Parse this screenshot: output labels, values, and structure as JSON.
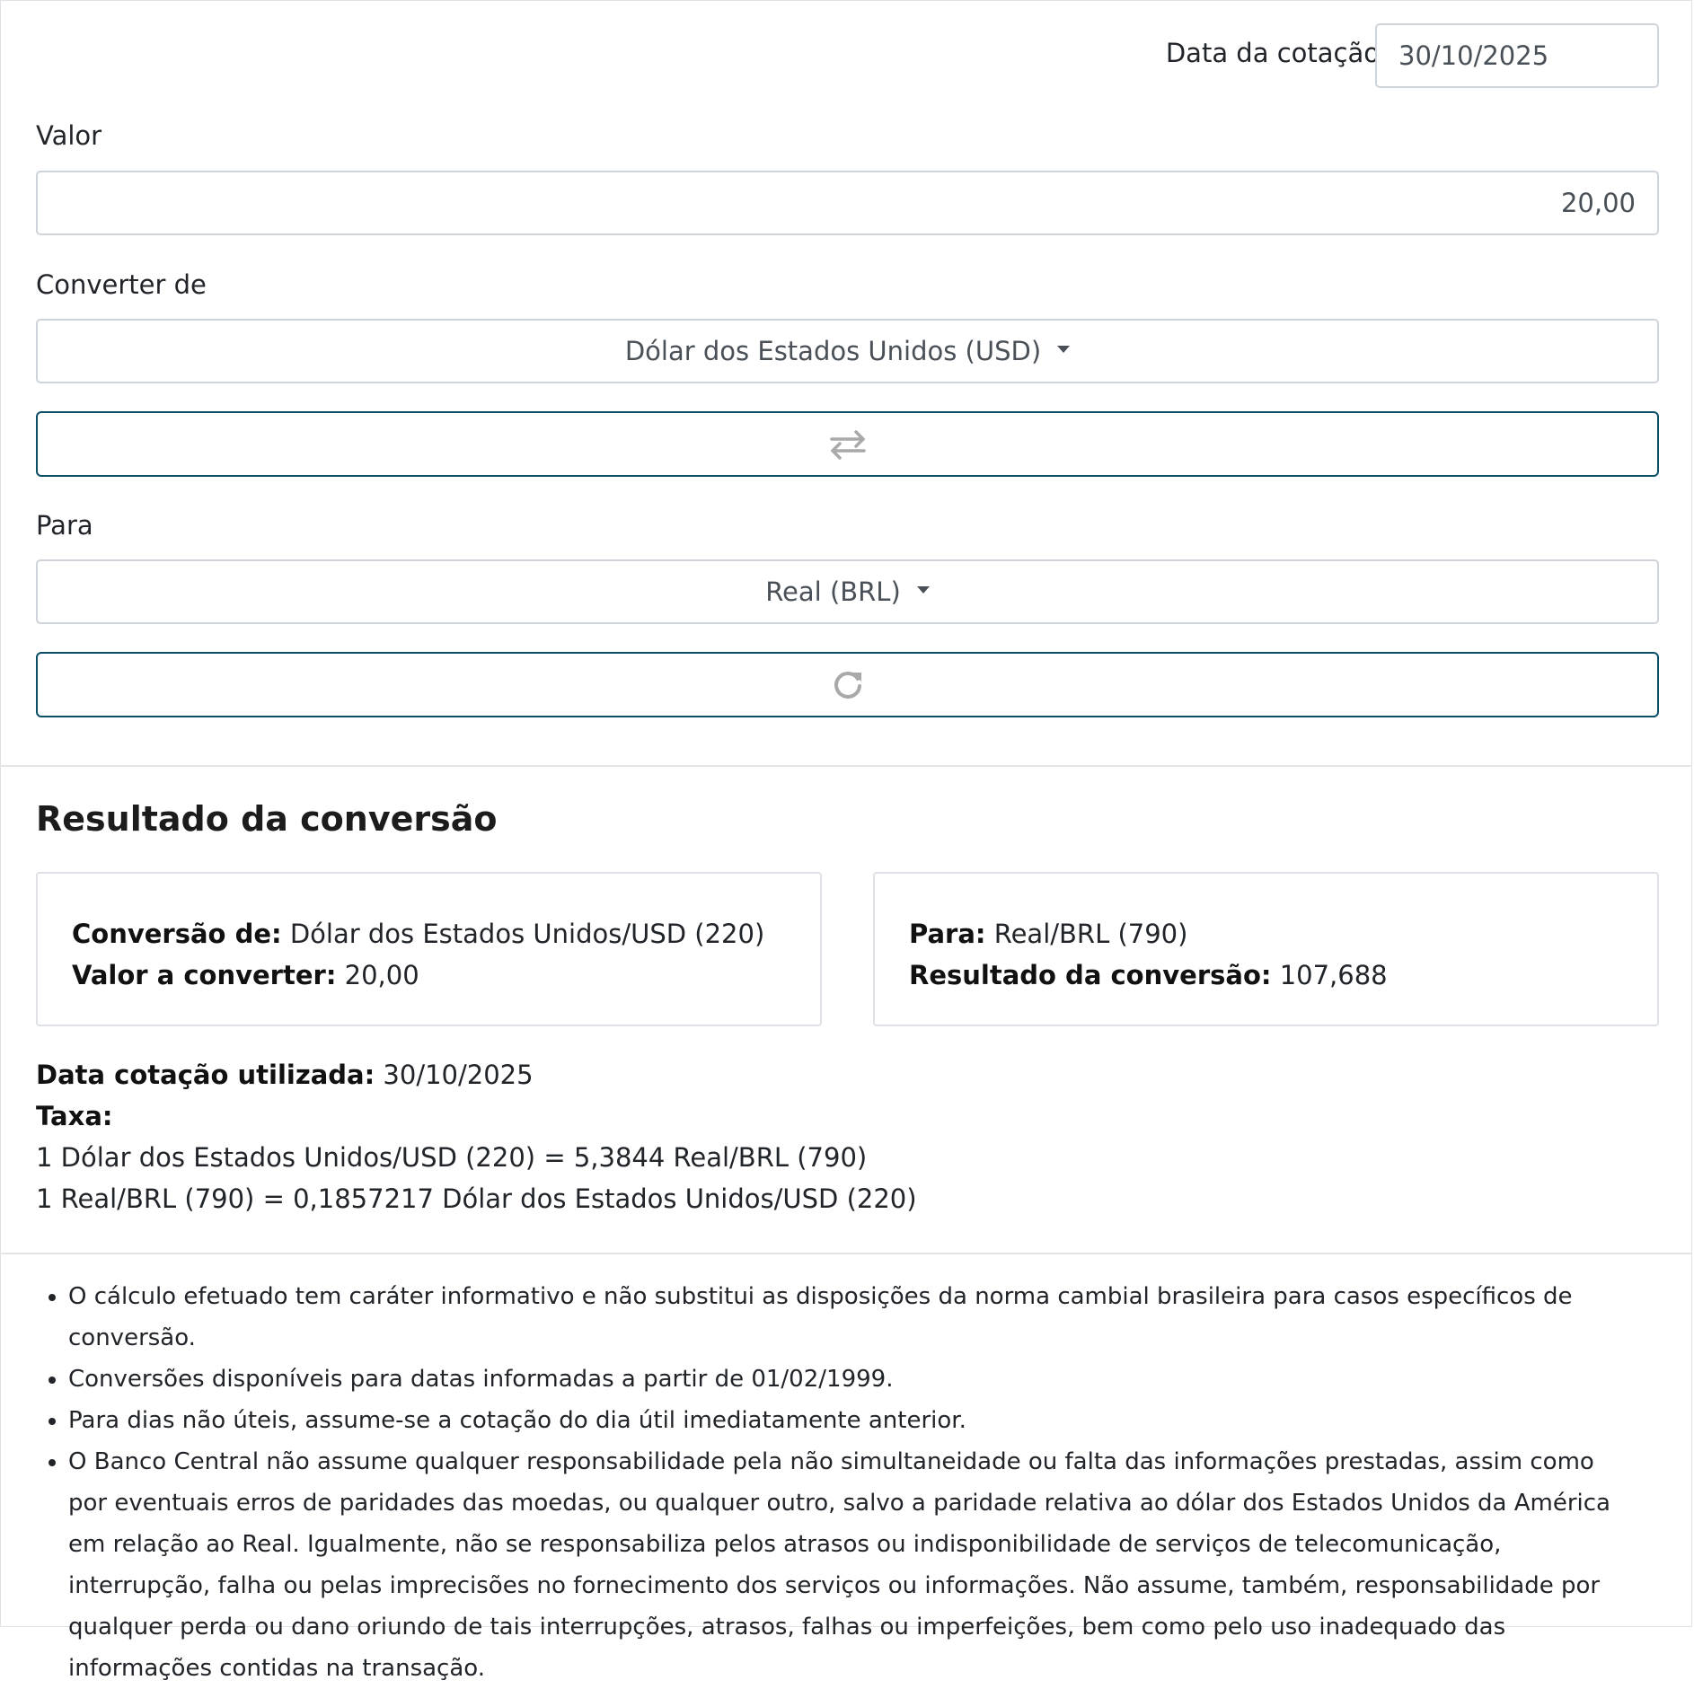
{
  "form": {
    "date_label": "Data da cotação",
    "date_value": "30/10/2025",
    "value_label": "Valor",
    "value_input": "20,00",
    "from_label": "Converter de",
    "from_currency": "Dólar dos Estados Unidos (USD)",
    "swap_icon": "swap-arrows-icon",
    "to_label": "Para",
    "to_currency": "Real (BRL)",
    "convert_icon": "refresh-icon"
  },
  "result": {
    "heading": "Resultado da conversão",
    "card_from": {
      "conversion_from_label": "Conversão de:",
      "conversion_from_value": "Dólar dos Estados Unidos/USD (220)",
      "value_label": "Valor a converter:",
      "value": "20,00"
    },
    "card_to": {
      "to_label": "Para:",
      "to_value": "Real/BRL (790)",
      "result_label": "Resultado da conversão:",
      "result_value": "107,688"
    },
    "date_used_label": "Data cotação utilizada:",
    "date_used_value": "30/10/2025",
    "rate_label": "Taxa:",
    "rate_line_1": "1 Dólar dos Estados Unidos/USD (220) = 5,3844 Real/BRL (790)",
    "rate_line_2": "1 Real/BRL (790) = 0,1857217 Dólar dos Estados Unidos/USD (220)"
  },
  "notes": [
    "O cálculo efetuado tem caráter informativo e não substitui as disposições da norma cambial brasileira para casos específicos de conversão.",
    "Conversões disponíveis para datas informadas a partir de 01/02/1999.",
    "Para dias não úteis, assume-se a cotação do dia útil imediatamente anterior.",
    "O Banco Central não assume qualquer responsabilidade pela não simultaneidade ou falta das informações prestadas, assim como por eventuais erros de paridades das moedas, ou qualquer outro, salvo a paridade relativa ao dólar dos Estados Unidos da América em relação ao Real. Igualmente, não se responsabiliza pelos atrasos ou indisponibilidade de serviços de telecomunicação, interrupção, falha ou pelas imprecisões no fornecimento dos serviços ou informações. Não assume, também, responsabilidade por qualquer perda ou dano oriundo de tais interrupções, atrasos, falhas ou imperfeições, bem como pelo uso inadequado das informações contidas na transação."
  ]
}
